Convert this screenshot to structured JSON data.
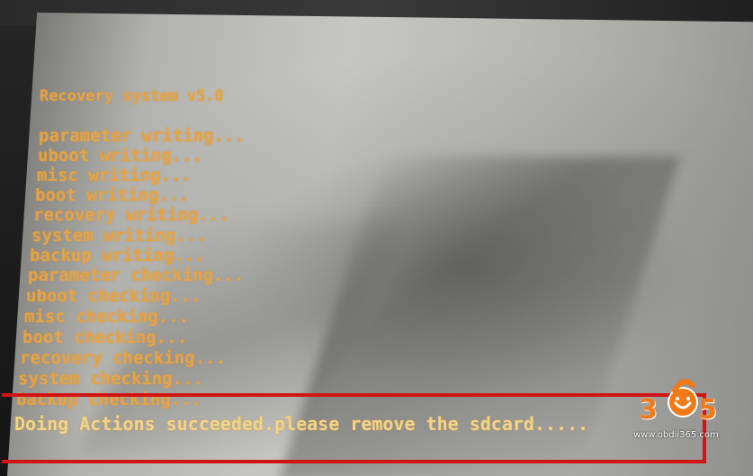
{
  "console": {
    "title": "Recovery system v5.0",
    "lines": [
      "parameter writing...",
      "uboot writing...",
      "misc writing...",
      "boot writing...",
      "recovery writing...",
      "system writing...",
      "backup writing...",
      "parameter checking...",
      "uboot checking...",
      "misc checking...",
      "boot checking...",
      "recovery checking...",
      "system checking...",
      "backup checking..."
    ],
    "status": "Doing Actions succeeded.please remove the sdcard....."
  },
  "watermark": {
    "digits": [
      "3",
      "6",
      "5"
    ],
    "url": "www.obdii365.com"
  },
  "colors": {
    "console_text": "#e3a347",
    "highlight_box": "#d11414",
    "logo_orange": "#f07a18"
  }
}
